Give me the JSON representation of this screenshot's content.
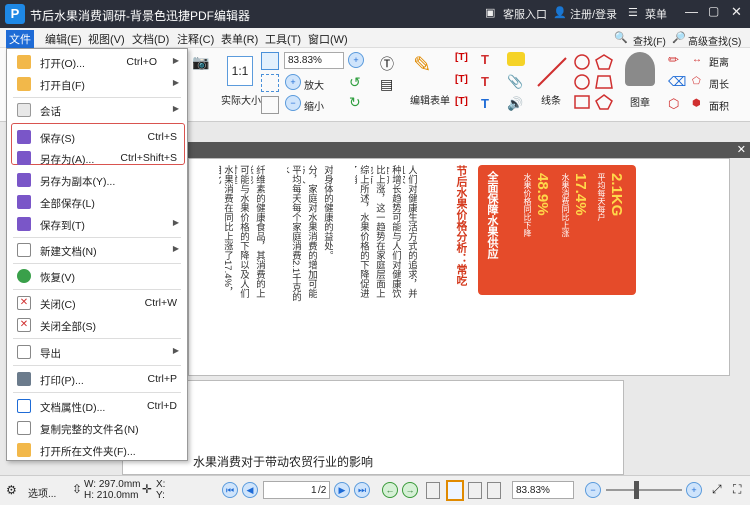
{
  "window": {
    "title": "节后水果消费调研-背景色迅捷PDF编辑器",
    "service": "客服入口",
    "login": "注册/登录",
    "menu": "菜单"
  },
  "menubar": [
    "文件",
    "编辑(E)",
    "视图(V)",
    "文档(D)",
    "注释(C)",
    "表单(R)",
    "工具(T)",
    "窗口(W)"
  ],
  "ribbon": {
    "zoom": "83.83%",
    "actual_size": "实际大小",
    "zoom_in": "放大",
    "zoom_out": "缩小",
    "edit_form": "编辑表单",
    "line": "线条",
    "stamp": "图章",
    "find": "查找(F)",
    "advanced_find": "高级查找(S)",
    "distance": "距离",
    "perimeter": "周长",
    "area": "面积"
  },
  "file_menu": [
    {
      "label": "打开(O)...",
      "shortcut": "Ctrl+O",
      "arrow": true
    },
    {
      "label": "打开自(F)",
      "shortcut": "",
      "arrow": true
    },
    {
      "label": "会话",
      "shortcut": "",
      "arrow": true
    },
    {
      "label": "保存(S)",
      "shortcut": "Ctrl+S",
      "arrow": false
    },
    {
      "label": "另存为(A)...",
      "shortcut": "Ctrl+Shift+S",
      "arrow": false
    },
    {
      "label": "另存为副本(Y)...",
      "shortcut": "",
      "arrow": false
    },
    {
      "label": "全部保存(L)",
      "shortcut": "",
      "arrow": false
    },
    {
      "label": "保存到(T)",
      "shortcut": "",
      "arrow": true
    },
    {
      "label": "新建文档(N)",
      "shortcut": "",
      "arrow": true
    },
    {
      "label": "恢复(V)",
      "shortcut": "",
      "arrow": false
    },
    {
      "label": "关闭(C)",
      "shortcut": "Ctrl+W",
      "arrow": false
    },
    {
      "label": "关闭全部(S)",
      "shortcut": "",
      "arrow": false
    },
    {
      "label": "导出",
      "shortcut": "",
      "arrow": true
    },
    {
      "label": "打印(P)...",
      "shortcut": "Ctrl+P",
      "arrow": false
    },
    {
      "label": "文档属性(D)...",
      "shortcut": "Ctrl+D",
      "arrow": false
    },
    {
      "label": "复制完整的文件名(N)",
      "shortcut": "",
      "arrow": false
    },
    {
      "label": "打开所在文件夹(F)...",
      "shortcut": "",
      "arrow": false
    }
  ],
  "document": {
    "columns": [
      "水果消费在同比上涨了17.4%，相比",
      "可能与水果价格的下降以及人们对健",
      "纤维素的健康食品，其消费的上涨也",
      "平均每天每个家庭消费2.1千克的水",
      "分，家庭对水果消费的增加可能与人",
      "对身体的健康的益处。",
      "综上所述，水果价格的下降促进了消",
      "比上涨，这一趋势在家庭层面上也有",
      "种增长趋势可能与人们对健康饮食的",
      "人们对健康生活方式的追求，并且农"
    ],
    "promo_heading": "节后水果价格分析：常吃",
    "promo_sub": "全面保障水果供应",
    "stats": [
      "48.9%",
      "17.4%",
      "2.1KG"
    ],
    "stat_labels": [
      "水果价格同比下降",
      "水果消费同比上涨",
      "平均每天每户"
    ],
    "page2_text": "水果消费对于带动农贸行业的影响"
  },
  "status": {
    "options": "选项...",
    "width": "W: 297.0mm",
    "height": "H: 210.0mm",
    "x": "X:",
    "y": "Y:",
    "page": "1",
    "page_total": "/2",
    "zoom": "83.83%"
  }
}
